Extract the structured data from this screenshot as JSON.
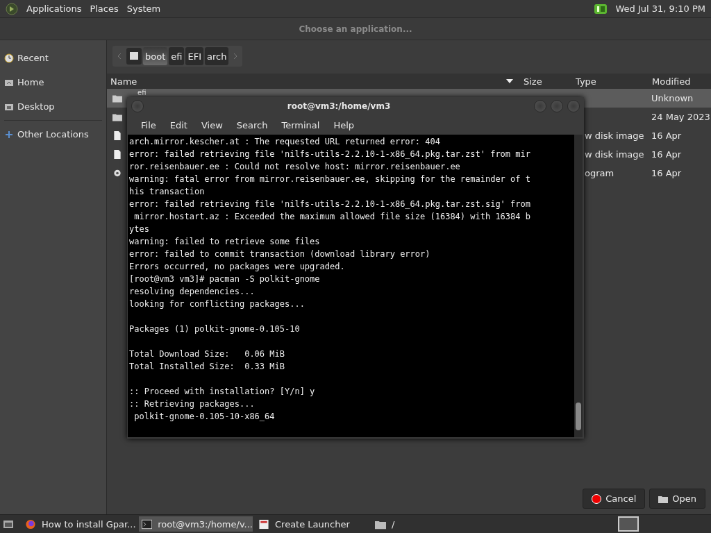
{
  "top_panel": {
    "menus": [
      "Applications",
      "Places",
      "System"
    ],
    "clock": "Wed Jul 31,  9:10 PM"
  },
  "dialog": {
    "title": "Choose an application...",
    "sidebar": {
      "items": [
        {
          "label": "Recent",
          "kind": "recent",
          "selected": false
        },
        {
          "label": "Home",
          "kind": "home",
          "selected": false
        },
        {
          "label": "Desktop",
          "kind": "desktop",
          "selected": false
        },
        {
          "label": "Other Locations",
          "kind": "other",
          "selected": false
        }
      ]
    },
    "path_bar": [
      {
        "label": "boot",
        "selected": true
      },
      {
        "label": "efi",
        "selected": false
      },
      {
        "label": "EFI",
        "selected": false
      },
      {
        "label": "arch",
        "selected": false
      }
    ],
    "columns": [
      "Name",
      "Size",
      "Type",
      "Modified"
    ],
    "rows": [
      {
        "kind": "folder",
        "name": "efi",
        "modified": "Unknown",
        "selected": true
      },
      {
        "kind": "folder",
        "modified": "24 May 2023",
        "selected": false
      },
      {
        "kind": "file",
        "type": "w disk image",
        "modified": "16 Apr",
        "selected": false
      },
      {
        "kind": "file",
        "type": "w disk image",
        "modified": "16 Apr",
        "selected": false
      },
      {
        "kind": "program",
        "type": "ogram",
        "modified": "16 Apr",
        "selected": false
      }
    ],
    "buttons": [
      {
        "label": "Cancel",
        "kind": "cancel"
      },
      {
        "label": "Open",
        "kind": "open"
      }
    ]
  },
  "terminal": {
    "title": "root@vm3:/home/vm3",
    "menus": [
      "File",
      "Edit",
      "View",
      "Search",
      "Terminal",
      "Help"
    ],
    "blocks": [
      [
        "arch.mirror.kescher.at : The requested URL returned error: 404",
        "error: failed retrieving file 'nilfs-utils-2.2.10-1-x86_64.pkg.tar.zst' from mir",
        "ror.reisenbauer.ee : Could not resolve host: mirror.reisenbauer.ee",
        "warning: fatal error from mirror.reisenbauer.ee, skipping for the remainder of t",
        "his transaction",
        "error: failed retrieving file 'nilfs-utils-2.2.10-1-x86_64.pkg.tar.zst.sig' from",
        " mirror.hostart.az : Exceeded the maximum allowed file size (16384) with 16384 b",
        "ytes",
        "warning: failed to retrieve some files",
        "error: failed to commit transaction (download library error)",
        "Errors occurred, no packages were upgraded.",
        "[root@vm3 vm3]# pacman -S polkit-gnome",
        "resolving dependencies...",
        "looking for conflicting packages..."
      ],
      [
        "Packages (1) polkit-gnome-0.105-10"
      ],
      [
        "Total Download Size:   0.06 MiB",
        "Total Installed Size:  0.33 MiB"
      ],
      [
        ":: Proceed with installation? [Y/n] y",
        ":: Retrieving packages...",
        " polkit-gnome-0.105-10-x86_64"
      ]
    ]
  },
  "taskbar": {
    "items": [
      {
        "label": "How to install Gpar...",
        "kind": "browser",
        "selected": false
      },
      {
        "label": "root@vm3:/home/v...",
        "kind": "terminal",
        "selected": true
      },
      {
        "label": "Create Launcher",
        "kind": "launcher",
        "selected": false
      },
      {
        "label": "/",
        "kind": "folder",
        "selected": false
      }
    ]
  }
}
